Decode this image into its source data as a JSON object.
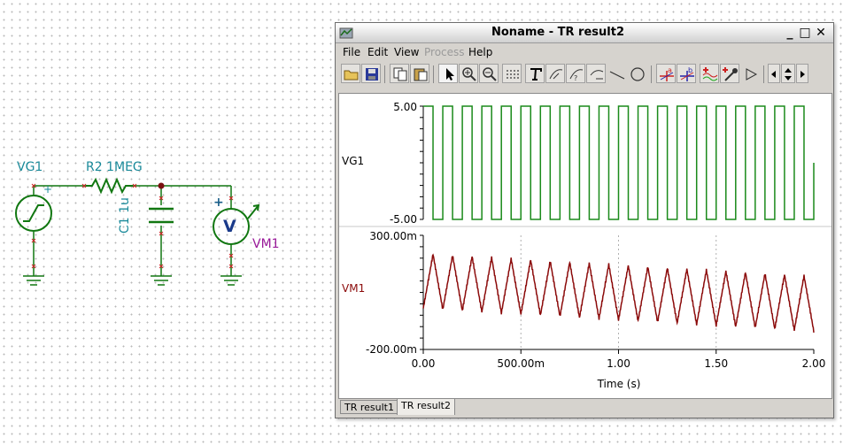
{
  "schematic": {
    "vg1_label": "VG1",
    "r2_label": "R2 1MEG",
    "c1_label": "C1 1u",
    "vm1_label": "VM1",
    "voltmeter_symbol": "V",
    "plus_sign": "+"
  },
  "window": {
    "title": "Noname - TR result2",
    "controls": {
      "minimize": "_",
      "maximize": "□",
      "close": "✕"
    }
  },
  "menu": {
    "items": [
      {
        "label": "File",
        "disabled": false
      },
      {
        "label": "Edit",
        "disabled": false
      },
      {
        "label": "View",
        "disabled": false
      },
      {
        "label": "Process",
        "disabled": true
      },
      {
        "label": "Help",
        "disabled": false
      }
    ]
  },
  "toolbar": {
    "icons": [
      "open-folder-icon",
      "save-icon",
      "copy-icon",
      "paste-icon",
      "pointer-icon",
      "zoom-in-icon",
      "zoom-out-icon",
      "grid-icon",
      "text-tool-icon",
      "curve-label-icon",
      "curve-label-2-icon",
      "curve-label-3-icon",
      "line-tool-icon",
      "ellipse-tool-icon",
      "cursor-a-icon",
      "cursor-b-icon",
      "add-curve-icon",
      "color-picker-icon",
      "play-icon",
      "scroll-left-icon",
      "scroll-updown-icon",
      "scroll-right-icon"
    ]
  },
  "tabs": [
    {
      "label": "TR result1",
      "active": false
    },
    {
      "label": "TR result2",
      "active": true
    }
  ],
  "colors": {
    "vg1_trace": "#1a8a1a",
    "vm1_trace": "#8b0a0a",
    "schematic_wire": "#117711",
    "schematic_label": "#1a8a9a",
    "vm1_label": "#9a1a9a"
  },
  "chart_data": [
    {
      "type": "line",
      "ylabel": "VG1",
      "xlabel": "",
      "ylim": [
        -5,
        5
      ],
      "xlim": [
        0,
        2
      ],
      "y_tick_labels": [
        "5.00",
        "-5.00"
      ],
      "series": [
        {
          "name": "VG1",
          "waveform": "square",
          "period": 0.1,
          "high": 5,
          "low": -5,
          "x": [
            0,
            2
          ]
        }
      ]
    },
    {
      "type": "line",
      "ylabel": "VM1",
      "xlabel": "Time (s)",
      "ylim": [
        -0.2,
        0.3
      ],
      "xlim": [
        0,
        2
      ],
      "y_tick_labels": [
        "300.00m",
        "-200.00m"
      ],
      "x_tick_labels": [
        "0.00",
        "500.00m",
        "1.00",
        "1.50",
        "2.00"
      ],
      "x_ticks": [
        0,
        0.5,
        1.0,
        1.5,
        2.0
      ],
      "grid": "vertical dashed",
      "series": [
        {
          "name": "VM1",
          "waveform": "triangle",
          "period": 0.1,
          "x": [
            0,
            2
          ],
          "peak_start": 0.22,
          "trough_start": -0.02,
          "peak_end": 0.12,
          "trough_end": -0.12
        }
      ]
    }
  ]
}
